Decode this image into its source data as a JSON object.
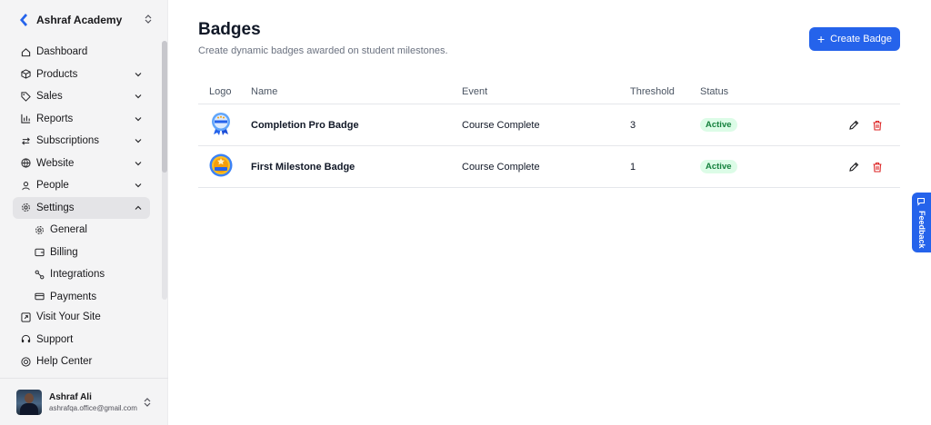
{
  "workspace": {
    "name": "Ashraf Academy"
  },
  "nav": {
    "items": [
      {
        "label": "Dashboard",
        "icon": "home-icon",
        "expandable": false
      },
      {
        "label": "Products",
        "icon": "box-icon",
        "expandable": true
      },
      {
        "label": "Sales",
        "icon": "tag-icon",
        "expandable": true
      },
      {
        "label": "Reports",
        "icon": "bar-chart-icon",
        "expandable": true
      },
      {
        "label": "Subscriptions",
        "icon": "repeat-icon",
        "expandable": true
      },
      {
        "label": "Website",
        "icon": "globe-icon",
        "expandable": true
      },
      {
        "label": "People",
        "icon": "user-icon",
        "expandable": true
      },
      {
        "label": "Settings",
        "icon": "gear-icon",
        "expandable": true,
        "expanded": true
      }
    ],
    "settings_sub": [
      {
        "label": "General",
        "icon": "gear-icon"
      },
      {
        "label": "Billing",
        "icon": "wallet-icon"
      },
      {
        "label": "Integrations",
        "icon": "link-icon"
      },
      {
        "label": "Payments",
        "icon": "card-icon"
      }
    ],
    "bottom": [
      {
        "label": "Visit Your Site",
        "icon": "external-link-icon"
      },
      {
        "label": "Support",
        "icon": "headset-icon"
      },
      {
        "label": "Help Center",
        "icon": "lifebuoy-icon"
      }
    ]
  },
  "user": {
    "name": "Ashraf Ali",
    "email": "ashrafqa.office@gmail.com"
  },
  "page": {
    "title": "Badges",
    "subtitle": "Create dynamic badges awarded on student milestones.",
    "create_label": "Create Badge"
  },
  "table": {
    "headers": {
      "logo": "Logo",
      "name": "Name",
      "event": "Event",
      "threshold": "Threshold",
      "status": "Status"
    },
    "rows": [
      {
        "name": "Completion Pro Badge",
        "event": "Course Complete",
        "threshold": "3",
        "status": "Active"
      },
      {
        "name": "First Milestone Badge",
        "event": "Course Complete",
        "threshold": "1",
        "status": "Active"
      }
    ]
  },
  "feedback": {
    "label": "Feedback"
  },
  "colors": {
    "accent": "#2563eb",
    "active_bg": "#dcfce7",
    "active_text": "#15803d",
    "delete": "#dc2626"
  }
}
